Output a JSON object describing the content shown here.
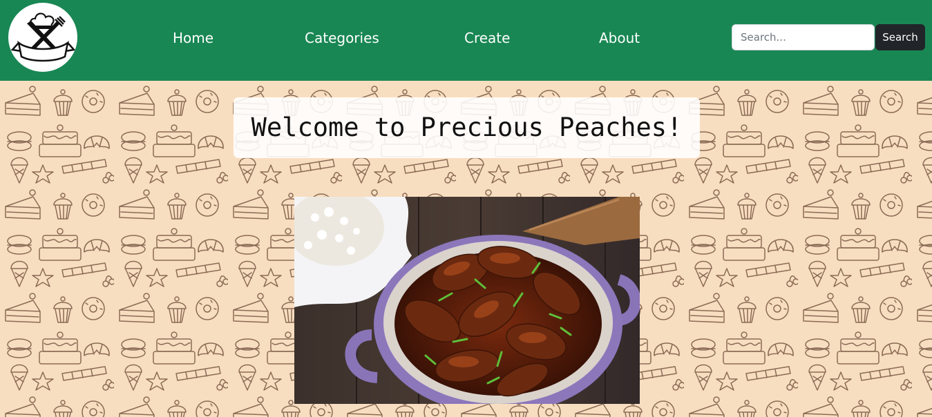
{
  "nav": {
    "logo_icon": "chef-hat-fork-knife-icon",
    "links": [
      {
        "label": "Home"
      },
      {
        "label": "Categories"
      },
      {
        "label": "Create"
      },
      {
        "label": "About"
      }
    ],
    "search": {
      "placeholder": "Search...",
      "value": "",
      "button_label": "Search"
    }
  },
  "hero": {
    "title": "Welcome to Precious Peaches!",
    "background_motif": "hand-drawn-desserts-pattern",
    "image_subject": "braised-chicken-with-rice-photo"
  },
  "colors": {
    "navbar": "#198754",
    "search_button": "#212529",
    "hero_background": "#f8dec0",
    "pattern_stroke": "#8a6a55"
  }
}
